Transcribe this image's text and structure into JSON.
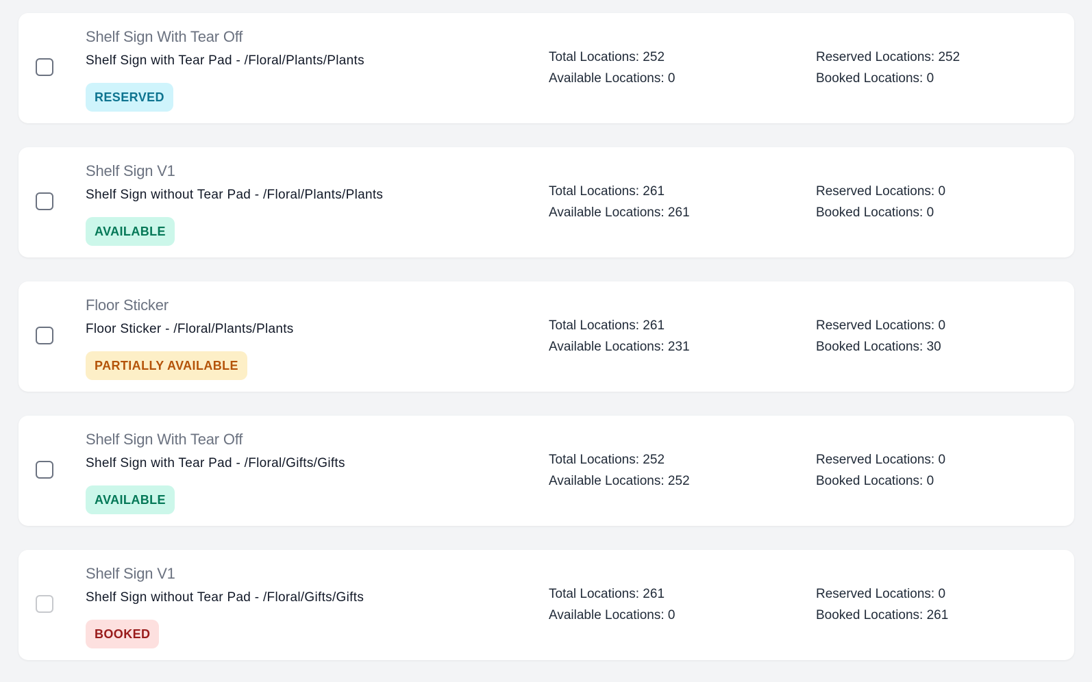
{
  "items": [
    {
      "title": "Shelf Sign With Tear Off",
      "description": "Shelf Sign with Tear Pad - /Floral/Plants/Plants",
      "status": "RESERVED",
      "status_colors": {
        "bg": "#cff4fc",
        "fg": "#0e7490"
      },
      "total": "Total Locations: 252",
      "available": "Available Locations: 0",
      "reserved": "Reserved Locations: 252",
      "booked": "Booked Locations: 0",
      "checkbox_enabled": true
    },
    {
      "title": "Shelf Sign V1",
      "description": "Shelf Sign without Tear Pad - /Floral/Plants/Plants",
      "status": "AVAILABLE",
      "status_colors": {
        "bg": "#ccf7ea",
        "fg": "#047857"
      },
      "total": "Total Locations: 261",
      "available": "Available Locations: 261",
      "reserved": "Reserved Locations: 0",
      "booked": "Booked Locations: 0",
      "checkbox_enabled": true
    },
    {
      "title": "Floor Sticker",
      "description": "Floor Sticker - /Floral/Plants/Plants",
      "status": "PARTIALLY AVAILABLE",
      "status_colors": {
        "bg": "#fdefc7",
        "fg": "#b45309"
      },
      "total": "Total Locations: 261",
      "available": "Available Locations: 231",
      "reserved": "Reserved Locations: 0",
      "booked": "Booked Locations: 30",
      "checkbox_enabled": true
    },
    {
      "title": "Shelf Sign With Tear Off",
      "description": "Shelf Sign with Tear Pad - /Floral/Gifts/Gifts",
      "status": "AVAILABLE",
      "status_colors": {
        "bg": "#ccf7ea",
        "fg": "#047857"
      },
      "total": "Total Locations: 252",
      "available": "Available Locations: 252",
      "reserved": "Reserved Locations: 0",
      "booked": "Booked Locations: 0",
      "checkbox_enabled": true
    },
    {
      "title": "Shelf Sign V1",
      "description": "Shelf Sign without Tear Pad - /Floral/Gifts/Gifts",
      "status": "BOOKED",
      "status_colors": {
        "bg": "#fde0df",
        "fg": "#991b1b"
      },
      "total": "Total Locations: 261",
      "available": "Available Locations: 0",
      "reserved": "Reserved Locations: 0",
      "booked": "Booked Locations: 261",
      "checkbox_enabled": false
    }
  ]
}
